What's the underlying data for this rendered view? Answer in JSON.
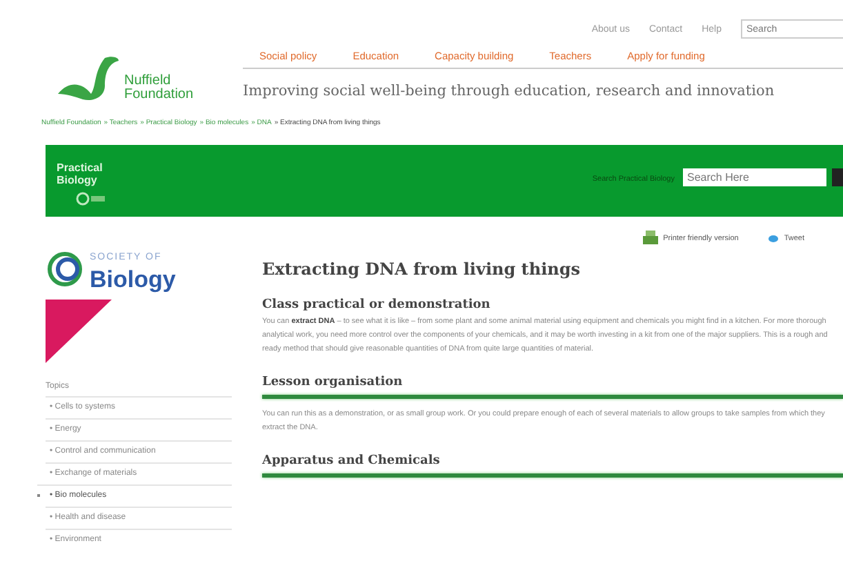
{
  "logo": {
    "line_1": "Nuffield",
    "line_2": "Foundation"
  },
  "utility_links": [
    "About us",
    "Contact",
    "Help"
  ],
  "utility_search": {
    "placeholder": "Search"
  },
  "main_menu": [
    "Social policy",
    "Education",
    "Capacity building",
    "Teachers",
    "Apply for funding"
  ],
  "tagline": "Improving social well-being through education, research and innovation",
  "breadcrumb": [
    "Nuffield Foundation",
    "» Teachers",
    "» Practical Biology",
    "» Bio molecules",
    "» DNA",
    "» Extracting DNA from living things"
  ],
  "banner": {
    "title_1": "Practical",
    "title_2": "Biology",
    "search_label": "Search Practical Biology",
    "search_placeholder": "Search Here"
  },
  "society_logo": {
    "line_1": "SOCIETY OF",
    "line_2": "Biology"
  },
  "sidebar": {
    "heading": "Topics",
    "items": [
      {
        "label": "• Cells to systems",
        "selected": false
      },
      {
        "label": "• Energy",
        "selected": false
      },
      {
        "label": "• Control and communication",
        "selected": false
      },
      {
        "label": "• Exchange of materials",
        "selected": false
      },
      {
        "label": "• Bio molecules",
        "selected": true
      },
      {
        "label": "• Health and disease",
        "selected": false
      },
      {
        "label": "• Environment",
        "selected": false
      }
    ]
  },
  "actions": [
    "Printer friendly version",
    "Tweet"
  ],
  "article": {
    "title": "Extracting DNA from living things",
    "sections": [
      {
        "heading": "Class practical or demonstration",
        "kind": "plain",
        "text": "You can **extract DNA** – to see what it is like – from some plant and some animal material using equipment and chemicals you might find in a kitchen. For more thorough analytical work, you need more control over the components of your chemicals, and it may be worth investing in a kit from one of the major suppliers. This is a rough and ready method that should give reasonable quantities of DNA from quite large quantities of material."
      },
      {
        "heading": "Lesson organisation",
        "kind": "ruled",
        "text": "You can run this as a demonstration, or as small group work. Or you could prepare enough of each of several materials to allow groups to take samples from which they extract the DNA."
      },
      {
        "heading": "Apparatus and Chemicals",
        "kind": "ruled"
      }
    ]
  }
}
